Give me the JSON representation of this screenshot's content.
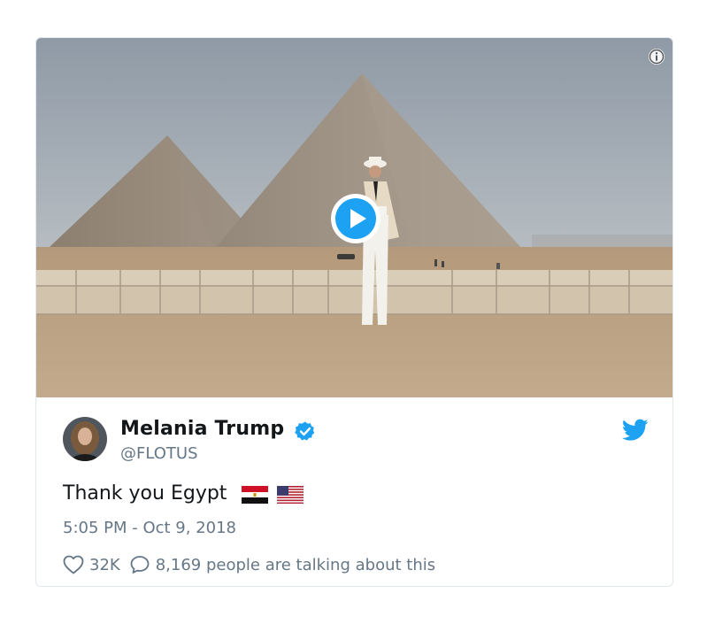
{
  "author": {
    "name": "Melania Trump",
    "handle": "@FLOTUS",
    "verified": true
  },
  "tweet": {
    "text": "Thank you Egypt",
    "flags": [
      "egypt-flag",
      "usa-flag"
    ],
    "timestamp": "5:05 PM - Oct 9, 2018"
  },
  "engagement": {
    "likes": "32K",
    "talking": "8,169 people are talking about this"
  },
  "media": {
    "type": "video",
    "scene": "pyramids-of-giza"
  },
  "icons": {
    "info": "info-icon",
    "play": "play-icon",
    "verified": "verified-badge-icon",
    "brand": "twitter-bird-icon",
    "like": "heart-icon",
    "reply": "speech-bubble-icon"
  },
  "colors": {
    "twitter_blue": "#1da1f2",
    "text_primary": "#14171a",
    "text_secondary": "#657786",
    "border": "#e1e8ed"
  }
}
